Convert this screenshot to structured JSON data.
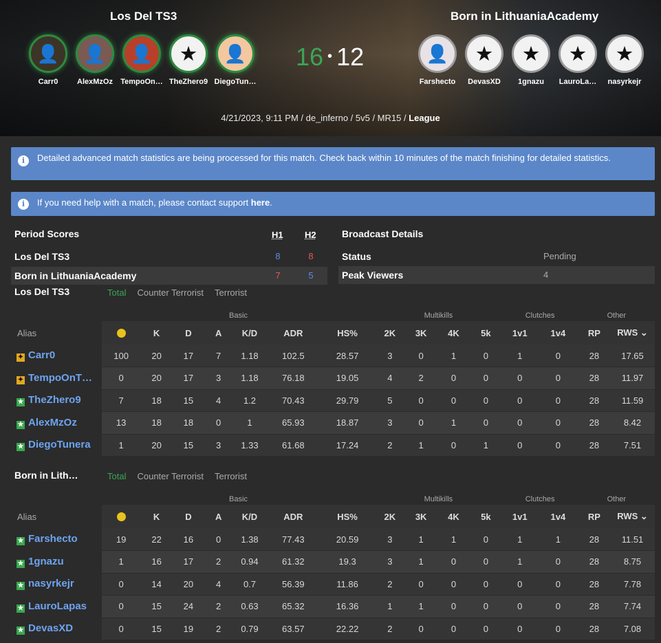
{
  "header": {
    "team_left": "Los Del TS3",
    "team_right": "Born in LithuaniaAcademy",
    "score_left": "16",
    "score_sep": "•",
    "score_right": "12",
    "meta_text": "4/21/2023, 9:11 PM / de_inferno / 5v5 / MR15 / ",
    "meta_type": "League",
    "left_players": [
      "Carr0",
      "AlexMzOz",
      "TempoOn…",
      "TheZhero9",
      "DiegoTun…"
    ],
    "right_players": [
      "Farshecto",
      "DevasXD",
      "1gnazu",
      "LauroLa…",
      "nasyrkejr"
    ]
  },
  "alerts": {
    "processing": "Detailed advanced match statistics are being processed for this match. Check back within 10 minutes of the match finishing for detailed statistics.",
    "help_prefix": "If you need help with a match, please contact support ",
    "help_link": "here",
    "help_suffix": "."
  },
  "period": {
    "title": "Period Scores",
    "h1": "H1",
    "h2": "H2",
    "rows": [
      {
        "team": "Los Del TS3",
        "h1": "8",
        "h2": "8"
      },
      {
        "team": "Born in LithuaniaAcademy",
        "h1": "7",
        "h2": "5"
      }
    ]
  },
  "broadcast": {
    "title": "Broadcast Details",
    "status_label": "Status",
    "status_value": "Pending",
    "viewers_label": "Peak Viewers",
    "viewers_value": "4"
  },
  "tabs": {
    "total": "Total",
    "ct": "Counter Terrorist",
    "t": "Terrorist"
  },
  "groups": {
    "basic": "Basic",
    "multikills": "Multikills",
    "clutches": "Clutches",
    "other": "Other"
  },
  "columns": {
    "alias": "Alias",
    "k": "K",
    "d": "D",
    "a": "A",
    "kd": "K/D",
    "adr": "ADR",
    "hs": "HS%",
    "k2": "2K",
    "k3": "3K",
    "k4": "4K",
    "k5": "5k",
    "c1": "1v1",
    "c4": "1v4",
    "rp": "RP",
    "rws": "RWS ⌄"
  },
  "team1": {
    "title": "Los Del TS3",
    "rows": [
      {
        "alias": "Carr0",
        "rank": "gold",
        "smile": "100",
        "k": "20",
        "d": "17",
        "a": "7",
        "kd": "1.18",
        "adr": "102.5",
        "hs": "28.57",
        "k2": "3",
        "k3": "0",
        "k4": "1",
        "k5": "0",
        "c1": "1",
        "c4": "0",
        "rp": "28",
        "rws": "17.65"
      },
      {
        "alias": "TempoOnT…",
        "rank": "gold",
        "smile": "0",
        "k": "20",
        "d": "17",
        "a": "3",
        "kd": "1.18",
        "adr": "76.18",
        "hs": "19.05",
        "k2": "4",
        "k3": "2",
        "k4": "0",
        "k5": "0",
        "c1": "0",
        "c4": "0",
        "rp": "28",
        "rws": "11.97"
      },
      {
        "alias": "TheZhero9",
        "rank": "green",
        "smile": "7",
        "k": "18",
        "d": "15",
        "a": "4",
        "kd": "1.2",
        "adr": "70.43",
        "hs": "29.79",
        "k2": "5",
        "k3": "0",
        "k4": "0",
        "k5": "0",
        "c1": "0",
        "c4": "0",
        "rp": "28",
        "rws": "11.59"
      },
      {
        "alias": "AlexMzOz",
        "rank": "green",
        "smile": "13",
        "k": "18",
        "d": "18",
        "a": "0",
        "kd": "1",
        "adr": "65.93",
        "hs": "18.87",
        "k2": "3",
        "k3": "0",
        "k4": "1",
        "k5": "0",
        "c1": "0",
        "c4": "0",
        "rp": "28",
        "rws": "8.42"
      },
      {
        "alias": "DiegoTunera",
        "rank": "green",
        "smile": "1",
        "k": "20",
        "d": "15",
        "a": "3",
        "kd": "1.33",
        "adr": "61.68",
        "hs": "17.24",
        "k2": "2",
        "k3": "1",
        "k4": "0",
        "k5": "1",
        "c1": "0",
        "c4": "0",
        "rp": "28",
        "rws": "7.51"
      }
    ]
  },
  "team2": {
    "title": "Born in Lith…",
    "rows": [
      {
        "alias": "Farshecto",
        "rank": "green",
        "smile": "19",
        "k": "22",
        "d": "16",
        "a": "0",
        "kd": "1.38",
        "adr": "77.43",
        "hs": "20.59",
        "k2": "3",
        "k3": "1",
        "k4": "1",
        "k5": "0",
        "c1": "1",
        "c4": "1",
        "rp": "28",
        "rws": "11.51"
      },
      {
        "alias": "1gnazu",
        "rank": "green",
        "smile": "1",
        "k": "16",
        "d": "17",
        "a": "2",
        "kd": "0.94",
        "adr": "61.32",
        "hs": "19.3",
        "k2": "3",
        "k3": "1",
        "k4": "0",
        "k5": "0",
        "c1": "1",
        "c4": "0",
        "rp": "28",
        "rws": "8.75"
      },
      {
        "alias": "nasyrkejr",
        "rank": "green",
        "smile": "0",
        "k": "14",
        "d": "20",
        "a": "4",
        "kd": "0.7",
        "adr": "56.39",
        "hs": "11.86",
        "k2": "2",
        "k3": "0",
        "k4": "0",
        "k5": "0",
        "c1": "0",
        "c4": "0",
        "rp": "28",
        "rws": "7.78"
      },
      {
        "alias": "LauroLapas",
        "rank": "green",
        "smile": "0",
        "k": "15",
        "d": "24",
        "a": "2",
        "kd": "0.63",
        "adr": "65.32",
        "hs": "16.36",
        "k2": "1",
        "k3": "1",
        "k4": "0",
        "k5": "0",
        "c1": "0",
        "c4": "0",
        "rp": "28",
        "rws": "7.74"
      },
      {
        "alias": "DevasXD",
        "rank": "green",
        "smile": "0",
        "k": "15",
        "d": "19",
        "a": "2",
        "kd": "0.79",
        "adr": "63.57",
        "hs": "22.22",
        "k2": "2",
        "k3": "0",
        "k4": "0",
        "k5": "0",
        "c1": "0",
        "c4": "0",
        "rp": "28",
        "rws": "7.08"
      }
    ]
  },
  "colors": {
    "win": "#3aa655",
    "accent": "#5b87c9",
    "link": "#6ea3f0",
    "h_blue": "#5b8de6",
    "h_red": "#e05a5a"
  }
}
